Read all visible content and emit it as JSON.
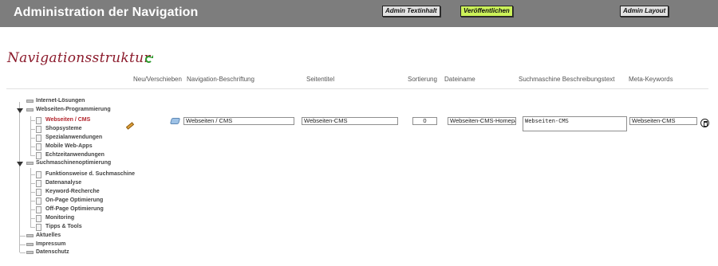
{
  "header": {
    "title": "Administration der Navigation",
    "buttons": {
      "text_content": "Admin Textinhalt",
      "publish": "Veröffentlichen",
      "layout": "Admin Layout"
    },
    "publish_color": "#ccf25a"
  },
  "page": {
    "title": "Navigationsstruktur",
    "refresh_icon": "refresh-icon"
  },
  "columns": {
    "move": "Neu/Verschieben",
    "label": "Navigation-Beschriftung",
    "page_title": "Seitentitel",
    "order": "Sortierung",
    "filename": "Dateiname",
    "description": "Suchmaschine Beschreibungstext",
    "keywords": "Meta-Keywords"
  },
  "tree": [
    {
      "label": "Internet-Lösungen",
      "level": 0,
      "expanded": false
    },
    {
      "label": "Webseiten-Programmierung",
      "level": 0,
      "expanded": true
    },
    {
      "label": "Webseiten / CMS",
      "level": 1,
      "selected": true
    },
    {
      "label": "Shopsysteme",
      "level": 1
    },
    {
      "label": "Spezialanwendungen",
      "level": 1
    },
    {
      "label": "Mobile Web-Apps",
      "level": 1
    },
    {
      "label": "Echtzeitanwendungen",
      "level": 1
    },
    {
      "label": "Suchmaschinenoptimierung",
      "level": 0,
      "expanded": true
    },
    {
      "label": "Funktionsweise d. Suchmaschine",
      "level": 1
    },
    {
      "label": "Datenanalyse",
      "level": 1
    },
    {
      "label": "Keyword-Recherche",
      "level": 1
    },
    {
      "label": "On-Page Optimierung",
      "level": 1
    },
    {
      "label": "Off-Page Optimierung",
      "level": 1
    },
    {
      "label": "Monitoring",
      "level": 1
    },
    {
      "label": "Tipps & Tools",
      "level": 1
    },
    {
      "label": "Aktuelles",
      "level": 0,
      "expanded": false
    },
    {
      "label": "Impressum",
      "level": 0,
      "expanded": false
    },
    {
      "label": "Datenschutz",
      "level": 0,
      "expanded": false
    }
  ],
  "edit_row": {
    "label": "Webseiten / CMS",
    "page_title": "Webseiten-CMS",
    "order": "0",
    "filename": "Webseiten-CMS-Homepag",
    "description": "Webseiten-CMS",
    "keywords": "Webseiten-CMS"
  },
  "icons": {
    "edit": "pencil-icon",
    "move": "move-icon",
    "delete": "delete-icon"
  },
  "colors": {
    "topbar": "#7d7d7d",
    "title": "#8b1a2b",
    "selected_item": "#b3242c"
  }
}
